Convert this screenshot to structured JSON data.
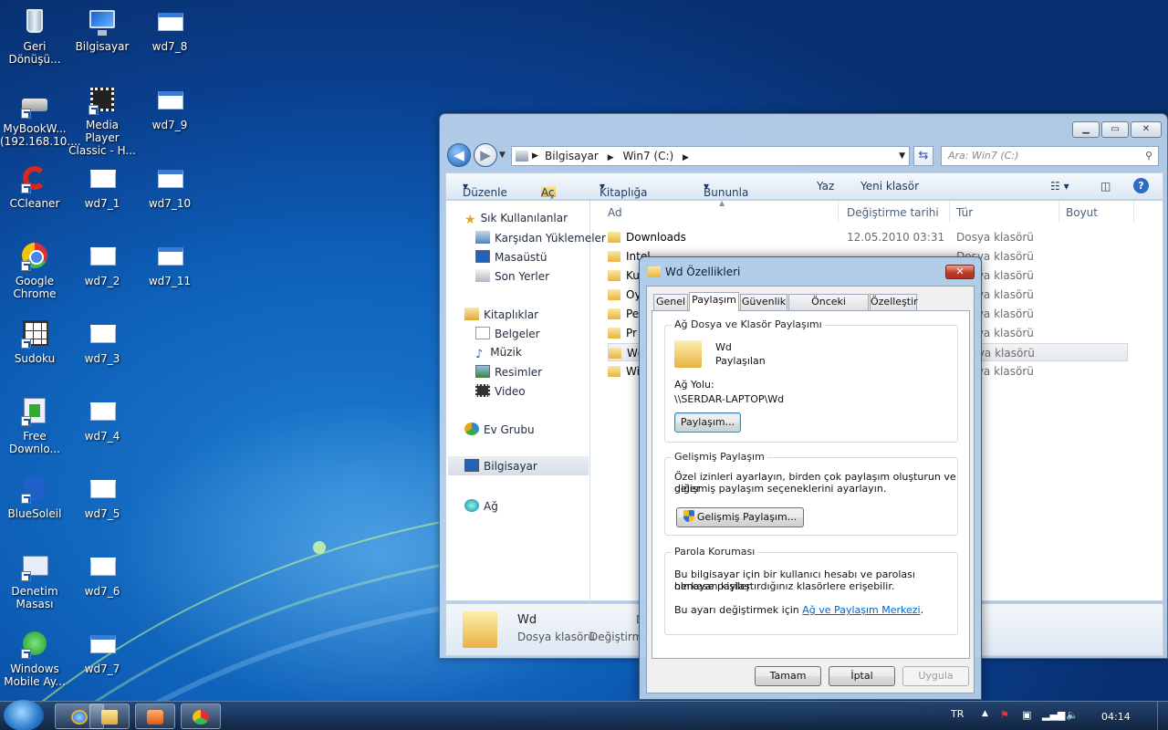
{
  "desktop": {
    "col1": [
      {
        "label": "Geri Dönüşü...",
        "icon": "recycle-bin-icon"
      },
      {
        "label": "MyBookW... (192.168.10....",
        "icon": "network-drive-icon"
      },
      {
        "label": "CCleaner",
        "icon": "ccleaner-icon"
      },
      {
        "label": "Google Chrome",
        "icon": "chrome-icon"
      },
      {
        "label": "Sudoku",
        "icon": "sudoku-icon"
      },
      {
        "label": "Free Downlo...",
        "icon": "download-manager-icon"
      },
      {
        "label": "BlueSoleil",
        "icon": "bluetooth-icon"
      },
      {
        "label": "Denetim Masası",
        "icon": "control-panel-icon"
      },
      {
        "label": "Windows Mobile Ay...",
        "icon": "windows-mobile-icon"
      }
    ],
    "col2": [
      {
        "label": "Bilgisayar",
        "icon": "computer-icon"
      },
      {
        "label": "Media Player Classic - H...",
        "icon": "media-player-icon"
      },
      {
        "label": "wd7_1"
      },
      {
        "label": "wd7_2"
      },
      {
        "label": "wd7_3"
      },
      {
        "label": "wd7_4"
      },
      {
        "label": "wd7_5"
      },
      {
        "label": "wd7_6"
      },
      {
        "label": "wd7_7"
      }
    ],
    "col3": [
      {
        "label": "wd7_8"
      },
      {
        "label": "wd7_9"
      },
      {
        "label": "wd7_10"
      },
      {
        "label": "wd7_11"
      }
    ]
  },
  "explorer": {
    "address": [
      "Bilgisayar",
      "Win7 (C:)"
    ],
    "search_placeholder": "Ara: Win7 (C:)",
    "toolbar": {
      "organize": "Düzenle",
      "open": "Aç",
      "include": "Kitaplığa ekle",
      "share": "Bununla paylaş",
      "print": "Yaz",
      "new_folder": "Yeni klasör"
    },
    "nav": {
      "favorites": "Sık Kullanılanlar",
      "downloads": "Karşıdan Yüklemeler",
      "desktop": "Masaüstü",
      "recent": "Son Yerler",
      "libraries": "Kitaplıklar",
      "documents": "Belgeler",
      "music": "Müzik",
      "pictures": "Resimler",
      "video": "Video",
      "homegroup": "Ev Grubu",
      "computer": "Bilgisayar",
      "network": "Ağ"
    },
    "columns": {
      "name": "Ad",
      "date": "Değiştirme tarihi",
      "type": "Tür",
      "size": "Boyut"
    },
    "rows": [
      {
        "name": "Downloads",
        "date": "12.05.2010 03:31",
        "type": "Dosya klasörü"
      },
      {
        "name": "Intel",
        "date": "",
        "type": "Dosya klasörü"
      },
      {
        "name": "Ku",
        "date": "",
        "type": "Dosya klasörü"
      },
      {
        "name": "Oy",
        "date": "",
        "type": "Dosya klasörü"
      },
      {
        "name": "Pe",
        "date": "",
        "type": "Dosya klasörü"
      },
      {
        "name": "Pr",
        "date": "",
        "type": "Dosya klasörü"
      },
      {
        "name": "Wd",
        "date": "",
        "type": "Dosya klasörü"
      },
      {
        "name": "Wi",
        "date": "",
        "type": "Dosya klasörü"
      }
    ],
    "details": {
      "name": "Wd",
      "type": "Dosya klasörü",
      "modified_label": "Değiştirme",
      "partial": "D"
    }
  },
  "dialog": {
    "title": "Wd Özellikleri",
    "close": "✕",
    "tabs": [
      "Genel",
      "Paylaşım",
      "Güvenlik",
      "Önceki Sürümler",
      "Özelleştir"
    ],
    "network": {
      "legend": "Ağ Dosya ve Klasör Paylaşımı",
      "folder": "Wd",
      "state": "Paylaşılan",
      "path_label": "Ağ Yolu:",
      "path": "\\\\SERDAR-LAPTOP\\Wd",
      "button": "Paylaşım..."
    },
    "advanced": {
      "legend": "Gelişmiş Paylaşım",
      "text1": "Özel izinleri ayarlayın, birden çok paylaşım oluşturun ve diğer",
      "text2": "gelişmiş paylaşım seçeneklerini ayarlayın.",
      "button": "Gelişmiş Paylaşım..."
    },
    "password": {
      "legend": "Parola Koruması",
      "text1": "Bu bilgisayar için bir kullanıcı hesabı ve parolası olmayan kişiler",
      "text2": "herkese paylaştırdığınız klasörlere erişebilir.",
      "text3": "Bu ayarı değiştirmek için",
      "link": "Ağ ve Paylaşım Merkezi",
      "period": "."
    },
    "buttons": {
      "ok": "Tamam",
      "cancel": "İptal",
      "apply": "Uygula"
    }
  },
  "taskbar": {
    "language": "TR",
    "clock": "04:14"
  }
}
